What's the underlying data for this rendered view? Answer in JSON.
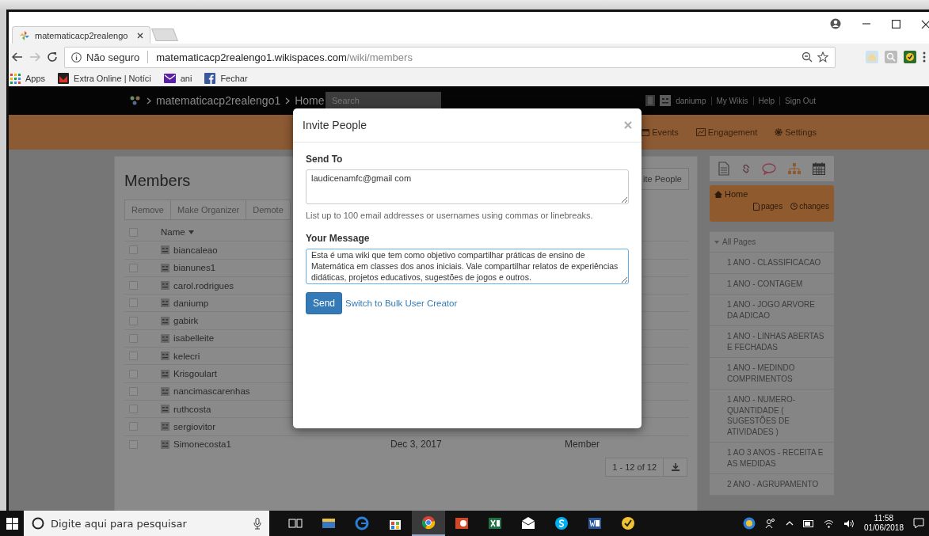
{
  "browser": {
    "tab_title": "matematicacp2realengo",
    "address": {
      "security": "Não seguro",
      "host": "matematicacp2realengo1.wikispaces.com",
      "path": "/wiki/members"
    },
    "bookmarks": [
      {
        "kind": "apps",
        "label": "Apps"
      },
      {
        "kind": "news",
        "label": "Extra Online | Notíci"
      },
      {
        "kind": "mail",
        "label": "ani"
      },
      {
        "kind": "facebook",
        "label": "Fechar"
      }
    ]
  },
  "site": {
    "breadcrumb": [
      "matematicacp2realengo1",
      "Home"
    ],
    "search": {
      "placeholder": "Search"
    },
    "user_links": [
      "daniump",
      "My Wikis",
      "Help",
      "Sign Out"
    ],
    "nav": [
      {
        "kind": "calendar",
        "label": "Events"
      },
      {
        "kind": "chart",
        "label": "Engagement"
      },
      {
        "kind": "gear",
        "label": "Settings"
      }
    ]
  },
  "members": {
    "title": "Members",
    "invite_button": "ite People",
    "actions": [
      "Remove",
      "Make Organizer",
      "Demote"
    ],
    "name_header": "Name",
    "select_all_checked": false,
    "rows": [
      {
        "name": "biancaleao",
        "checked": false
      },
      {
        "name": "bianunes1",
        "checked": false
      },
      {
        "name": "carol.rodrigues",
        "checked": false
      },
      {
        "name": "daniump",
        "checked": false
      },
      {
        "name": "gabirk",
        "checked": false
      },
      {
        "name": "isabelleite",
        "checked": false
      },
      {
        "name": "kelecri",
        "checked": false
      },
      {
        "name": "Krisgoulart",
        "checked": false
      },
      {
        "name": "nancimascarenhas",
        "checked": false
      },
      {
        "name": "ruthcosta",
        "checked": false
      },
      {
        "name": "sergiovitor",
        "checked": false
      },
      {
        "name": "Simonecosta1",
        "checked": false,
        "date": "Dec 3, 2017",
        "role": "Member"
      }
    ],
    "pagination": "1 - 12 of 12"
  },
  "sidebar": {
    "home": "Home",
    "home_links": [
      {
        "kind": "page",
        "label": "pages"
      },
      {
        "kind": "clock",
        "label": "changes"
      }
    ],
    "all_pages": "All Pages",
    "expanded": true,
    "pages": [
      "1 ANO - CLASSIFICACAO",
      "1 ANO - CONTAGEM",
      "1 ANO - JOGO ARVORE DA ADICAO",
      "1 ANO - LINHAS ABERTAS E FECHADAS",
      "1 ANO - MEDINDO COMPRIMENTOS",
      "1 ANO - NUMERO-QUANTIDADE ( SUGESTÕES DE ATIVIDADES )",
      "1 AO 3 ANOS - RECEITA E AS MEDIDAS",
      "2 ANO - AGRUPAMENTO"
    ]
  },
  "modal": {
    "title": "Invite People",
    "send_to_label": "Send To",
    "send_to_value": "laudicenamfc@gmail com",
    "hint": "List up to 100 email addresses or usernames using commas or linebreaks.",
    "message_label": "Your Message",
    "message_value": "Esta é uma wiki que tem como objetivo compartilhar práticas de ensino de Matemática em classes dos anos iniciais. Vale compartilhar relatos de experiências didáticas, projetos educativos, sugestões de jogos e outros.",
    "send_button": "Send",
    "bulk_link": "Switch to Bulk User Creator"
  },
  "taskbar": {
    "search": {
      "placeholder": "Digite aqui para pesquisar"
    },
    "time": "11:58",
    "date": "01/06/2018"
  }
}
